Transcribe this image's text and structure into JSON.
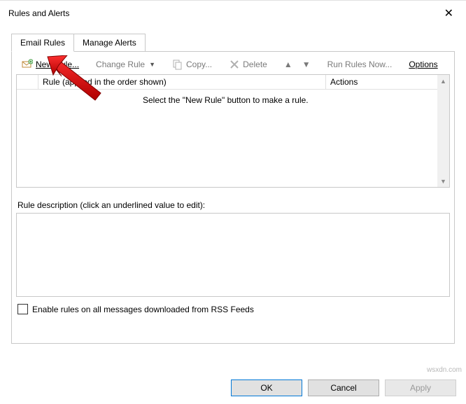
{
  "window": {
    "title": "Rules and Alerts",
    "close_glyph": "✕"
  },
  "tabs": {
    "email_rules": "Email Rules",
    "manage_alerts": "Manage Alerts"
  },
  "toolbar": {
    "new_rule": "New Rule...",
    "change_rule": "Change Rule",
    "copy": "Copy...",
    "delete": "Delete",
    "run_rules": "Run Rules Now...",
    "options": "Options"
  },
  "columns": {
    "rule": "Rule (applied in the order shown)",
    "actions": "Actions"
  },
  "list": {
    "empty_message": "Select the \"New Rule\" button to make a rule."
  },
  "description": {
    "label": "Rule description (click an underlined value to edit):"
  },
  "rss": {
    "label": "Enable rules on all messages downloaded from RSS Feeds"
  },
  "buttons": {
    "ok": "OK",
    "cancel": "Cancel",
    "apply": "Apply"
  },
  "watermark": "wsxdn.com"
}
